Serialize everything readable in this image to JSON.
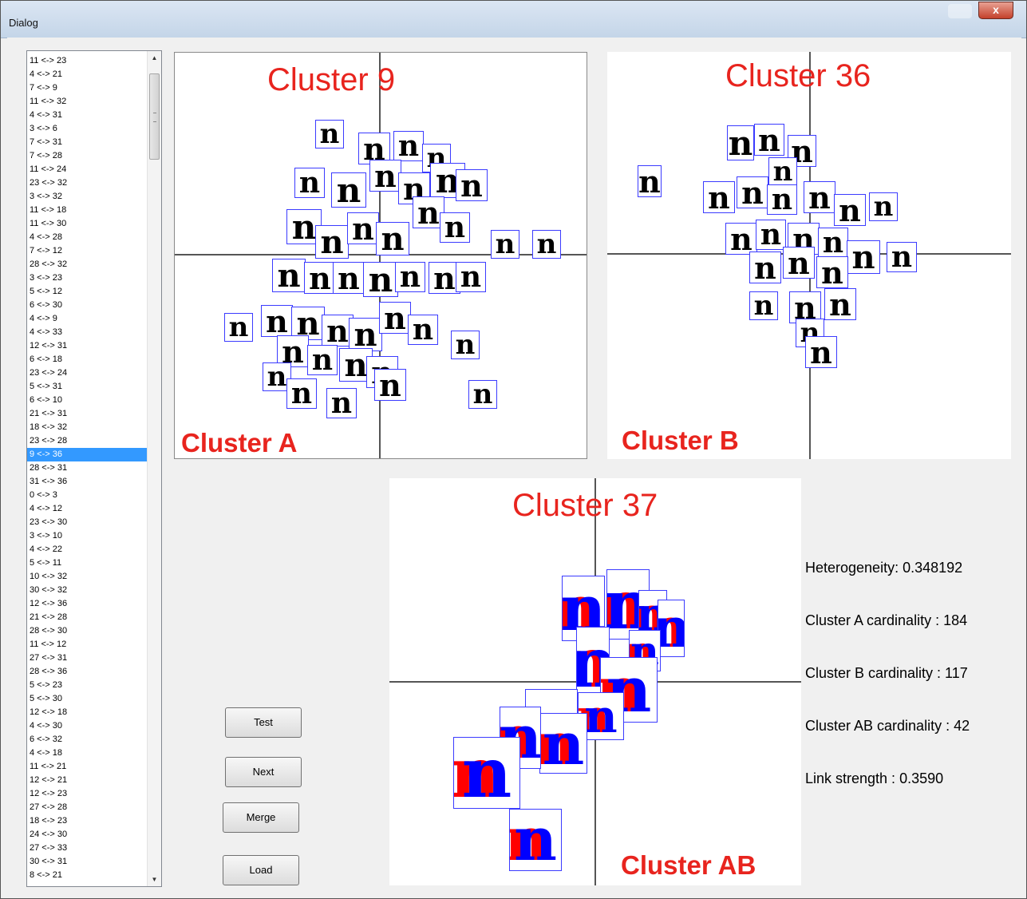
{
  "window": {
    "title": "Dialog",
    "close_glyph": "x"
  },
  "pair_list": {
    "items": [
      "11 <-> 23",
      "4 <-> 21",
      "7 <-> 9",
      "11 <-> 32",
      "4 <-> 31",
      "3 <-> 6",
      "7 <-> 31",
      "7 <-> 28",
      "11 <-> 24",
      "23 <-> 32",
      "3 <-> 32",
      "11 <-> 18",
      "11 <-> 30",
      "4 <-> 28",
      "7 <-> 12",
      "28 <-> 32",
      "3 <-> 23",
      "5 <-> 12",
      "6 <-> 30",
      "4 <-> 9",
      "4 <-> 33",
      "12 <-> 31",
      "6 <-> 18",
      "23 <-> 24",
      "5 <-> 31",
      "6 <-> 10",
      "21 <-> 31",
      "18 <-> 32",
      "23 <-> 28",
      "9 <-> 36",
      "28 <-> 31",
      "31 <-> 36",
      "0 <-> 3",
      "4 <-> 12",
      "23 <-> 30",
      "3 <-> 10",
      "4 <-> 22",
      "5 <-> 11",
      "10 <-> 32",
      "30 <-> 32",
      "12 <-> 36",
      "21 <-> 28",
      "28 <-> 30",
      "11 <-> 12",
      "27 <-> 31",
      "28 <-> 36",
      "5 <-> 23",
      "5 <-> 30",
      "12 <-> 18",
      "4 <-> 30",
      "6 <-> 32",
      "4 <-> 18",
      "11 <-> 21",
      "12 <-> 21",
      "12 <-> 23",
      "27 <-> 28",
      "18 <-> 23",
      "24 <-> 30",
      "27 <-> 33",
      "30 <-> 31",
      "8 <-> 21"
    ],
    "selected_index": 29
  },
  "panels": {
    "a": {
      "title": "Cluster 9",
      "label": "Cluster A"
    },
    "b": {
      "title": "Cluster 36",
      "label": "Cluster B"
    },
    "ab": {
      "title": "Cluster 37",
      "label": "Cluster AB"
    }
  },
  "stats": {
    "heterogeneity": "Heterogeneity: 0.348192",
    "card_a": "Cluster A cardinality : 184",
    "card_b": "Cluster B cardinality : 117",
    "card_ab": "Cluster AB cardinality : 42",
    "link": "Link strength : 0.3590"
  },
  "buttons": {
    "test": "Test",
    "next": "Next",
    "merge": "Merge",
    "load": "Load"
  },
  "glyph_chars": {
    "a": "n",
    "b": "n",
    "ab": "n"
  },
  "colors": {
    "label_red": "#e8241e",
    "box_blue": "#3b3bff",
    "ink_red": "#ff0000",
    "ink_blue": "#0000ff",
    "selection": "#3399ff"
  }
}
